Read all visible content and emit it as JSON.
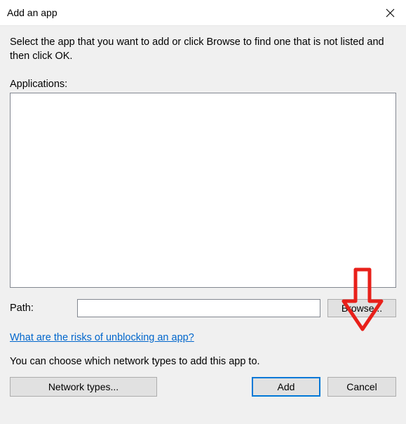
{
  "titlebar": {
    "title": "Add an app"
  },
  "content": {
    "instruction": "Select the app that you want to add or click Browse to find one that is not listed and then click OK.",
    "applications_label": "Applications:",
    "path_label": "Path:",
    "path_value": "",
    "browse_label": "Browse...",
    "risks_link": "What are the risks of unblocking an app?",
    "network_choice_text": "You can choose which network types to add this app to.",
    "network_types_label": "Network types...",
    "add_label": "Add",
    "cancel_label": "Cancel"
  }
}
